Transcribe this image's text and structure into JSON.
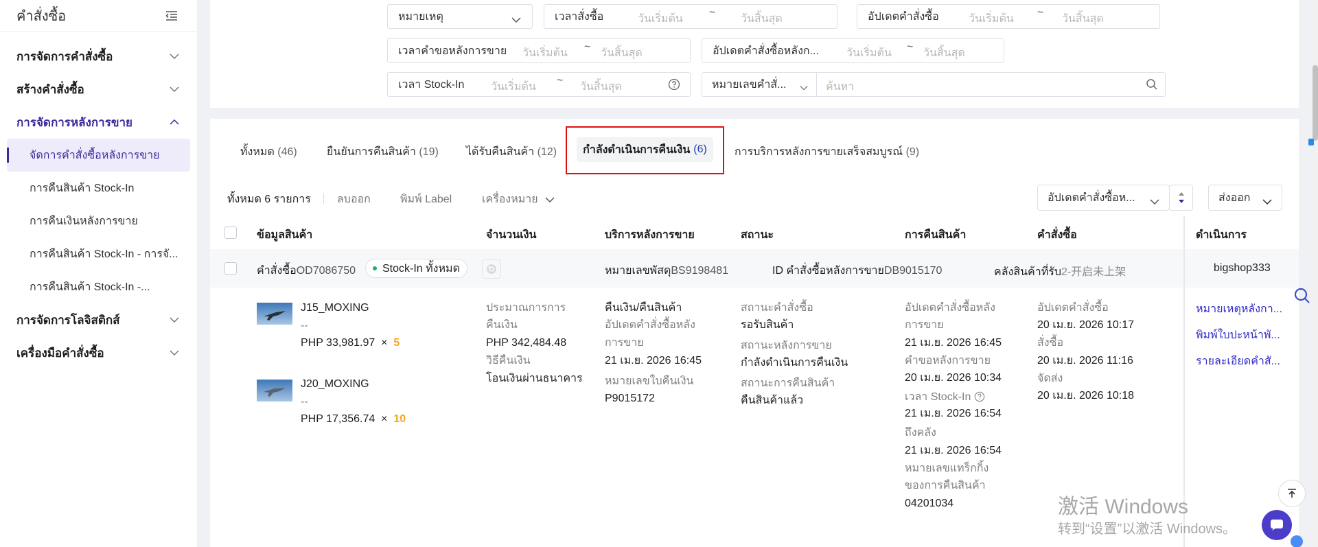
{
  "sidebar": {
    "title": "คำสั่งซื้อ",
    "groups": [
      {
        "label": "การจัดการคำสั่งซื้อ"
      },
      {
        "label": "สร้างคำสั่งซื้อ"
      },
      {
        "label": "การจัดการหลังการขาย"
      },
      {
        "label": "การจัดการโลจิสติกส์"
      },
      {
        "label": "เครื่องมือคำสั่งซื้อ"
      }
    ],
    "items": [
      {
        "label": "จัดการคำสั่งซื้อหลังการขาย"
      },
      {
        "label": "การคืนสินค้า Stock-In"
      },
      {
        "label": "การคืนเงินหลังการขาย"
      },
      {
        "label": "การคืนสินค้า Stock-In - การจั..."
      },
      {
        "label": "การคืนสินค้า Stock-In -..."
      }
    ]
  },
  "filters": {
    "reason": "หมายเหตุ",
    "order_time": "เวลาสั่งซื้อ",
    "order_update": "อัปเดตคำสั่งซื้อ",
    "aftersale_time": "เวลาคำขอหลังการขาย",
    "aftersale_update": "อัปเดตคำสั่งซื้อหลังก...",
    "stockin_time": "เวลา Stock-In",
    "order_no_select": "หมายเลขคำสั่...",
    "start_ph": "วันเริ่มต้น",
    "end_ph": "วันสิ้นสุด",
    "tilde": "~",
    "search_ph": "ค้นหา"
  },
  "tabs": {
    "all": "ทั้งหมด",
    "all_count": "(46)",
    "confirm": "ยืนยันการคืนสินค้า",
    "confirm_count": "(19)",
    "received": "ได้รับคืนสินค้า",
    "received_count": "(12)",
    "refunding": "กำลังดำเนินการคืนเงิน",
    "refunding_count": "(6)",
    "done": "การบริการหลังการขายเสร็จสมบูรณ์",
    "done_count": "(9)"
  },
  "toolbar": {
    "total": "ทั้งหมด 6 รายการ",
    "delete": "ลบออก",
    "print": "พิมพ์ Label",
    "marker": "เครื่องหมาย",
    "sort_select": "อัปเดตคำสั่งซื้อห...",
    "export": "ส่งออก"
  },
  "table": {
    "headers": [
      "ข้อมูลสินค้า",
      "จำนวนเงิน",
      "บริการหลังการขาย",
      "สถานะ",
      "การคืนสินค้า",
      "คำสั่งซื้อ",
      "ดำเนินการ"
    ],
    "order_row": {
      "order_prefix": "คำสั่งซื้อ",
      "order_no": "OD7086750",
      "stock_pill": "Stock-In ทั้งหมด",
      "tracking_prefix": "หมายเลขพัสดุ",
      "tracking_no": "BS9198481",
      "aftersale_prefix": "ID คำสั่งซื้อหลังการขาย",
      "aftersale_no": "DB9015170",
      "warehouse_prefix": "คลังสินค้าที่รับ",
      "warehouse": "2-开启未上架",
      "shop": "bigshop333"
    },
    "products": [
      {
        "name": "J15_MOXING",
        "spec": "--",
        "price": "PHP 33,981.97",
        "times": "×",
        "qty": "5"
      },
      {
        "name": "J20_MOXING",
        "spec": "--",
        "price": "PHP 17,356.74",
        "times": "×",
        "qty": "10"
      }
    ],
    "amount": {
      "l1": "ประมาณการการ",
      "l2": "คืนเงิน",
      "value": "PHP 342,484.48",
      "method_label": "วิธีคืนเงิน",
      "method": "โอนเงินผ่านธนาคาร"
    },
    "service": {
      "type": "คืนเงิน/คืนสินค้า",
      "upd_l1": "อัปเดตคำสั่งซื้อหลัง",
      "upd_l2": "การขาย",
      "upd_time": "21 เม.ย. 2026 16:45",
      "refund_no_label": "หมายเลขใบคืนเงิน",
      "refund_no": "P9015172"
    },
    "status": {
      "order_label": "สถานะคำสั่งซื้อ",
      "order": "รอรับสินค้า",
      "aftersale_label": "สถานะหลังการขาย",
      "aftersale": "กำลังดำเนินการคืนเงิน",
      "return_label": "สถานะการคืนสินค้า",
      "return": "คืนสินค้าแล้ว"
    },
    "returns": {
      "upd_l1": "อัปเดตคำสั่งซื้อหลัง",
      "upd_l2": "การขาย",
      "upd_time": "21 เม.ย. 2026 16:45",
      "req_label": "คำขอหลังการขาย",
      "req_time": "20 เม.ย. 2026 10:34",
      "stockin_label": "เวลา Stock-In",
      "stockin_time": "21 เม.ย. 2026 16:54",
      "arrive_label": "ถึงคลัง",
      "arrive_time": "21 เม.ย. 2026 16:54",
      "track_l1": "หมายเลขแทร็กกิ้ง",
      "track_l2": "ของการคืนสินค้า",
      "track_no": "04201034"
    },
    "order": {
      "upd_label": "อัปเดตคำสั่งซื้อ",
      "upd_time": "20 เม.ย. 2026 10:17",
      "ordered_label": "สั่งซื้อ",
      "ordered_time": "20 เม.ย. 2026 11:16",
      "ship_label": "จัดส่ง",
      "ship_time": "20 เม.ย. 2026 10:18"
    },
    "actions": [
      "หมายเหตุหลังกา...",
      "พิมพ์ใบปะหน้าพั...",
      "รายละเอียดคำสั..."
    ]
  },
  "watermark": {
    "line1": "激活 Windows",
    "line2": "转到“设置”以激活 Windows。"
  },
  "colors": {
    "accent": "#3a2a9b",
    "link": "#2f2bc7",
    "highlight": "#e01010",
    "qty": "#f5a623"
  }
}
